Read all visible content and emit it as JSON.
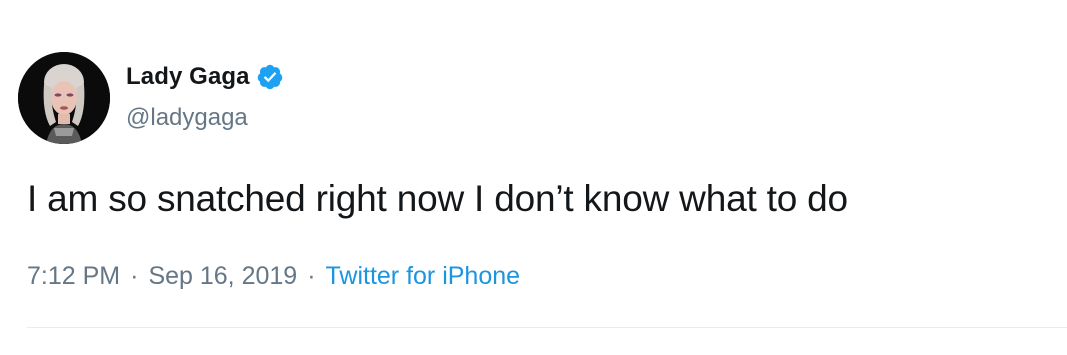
{
  "user": {
    "display_name": "Lady Gaga",
    "handle": "@ladygaga",
    "verified": true,
    "avatar_icon": "profile-photo"
  },
  "tweet": {
    "text": "I am so snatched right now I don’t know what to do",
    "time": "7:12 PM",
    "separator_1": "·",
    "date": "Sep 16, 2019",
    "separator_2": "·",
    "source": "Twitter for iPhone"
  },
  "colors": {
    "text_primary": "#14171a",
    "text_secondary": "#657786",
    "accent": "#1da1f2",
    "link": "#1b95e0",
    "divider": "#e6ecf0"
  }
}
